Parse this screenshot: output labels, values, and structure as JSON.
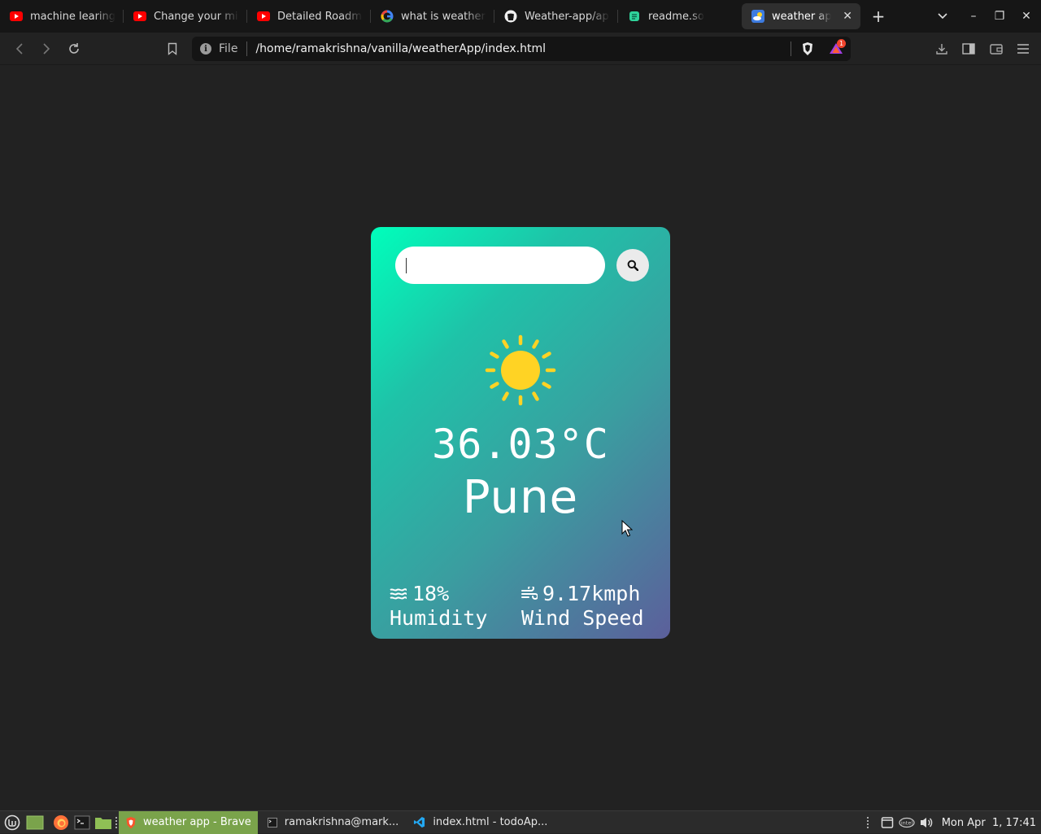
{
  "browser": {
    "tabs": [
      {
        "title": "machine learing ro",
        "icon": "youtube-icon"
      },
      {
        "title": "Change your mind",
        "icon": "youtube-icon"
      },
      {
        "title": "Detailed Roadmap",
        "icon": "youtube-icon"
      },
      {
        "title": "what is weather ap",
        "icon": "google-icon"
      },
      {
        "title": "Weather-app/app",
        "icon": "github-icon"
      },
      {
        "title": "readme.so",
        "icon": "readme-icon"
      },
      {
        "title": "weather app",
        "icon": "weather-icon",
        "active": true
      }
    ],
    "new_tab": "+",
    "address": {
      "scheme_label": "File",
      "url": "/home/ramakrishna/vanilla/weatherApp/index.html"
    },
    "rewards_badge": "1",
    "window_controls": {
      "minimize": "–",
      "maximize": "❐",
      "close": "✕"
    }
  },
  "weather": {
    "search": {
      "value": "",
      "placeholder": ""
    },
    "icon": "sun-icon",
    "temperature": "36.03°C",
    "city": "Pune",
    "humidity": {
      "value": "18%",
      "label": "Humidity"
    },
    "wind": {
      "value": "9.17kmph",
      "label": "Wind Speed"
    },
    "colors": {
      "gradient_start": "#00ffbb",
      "gradient_end": "#5c5f9b",
      "sun": "#ffd324"
    }
  },
  "taskbar": {
    "windows": [
      {
        "title": "weather app - Brave",
        "active": true
      },
      {
        "title": "ramakrishna@mark...",
        "active": false
      },
      {
        "title": "index.html - todoAp...",
        "active": false
      }
    ],
    "tray_brand": "intel",
    "clock": "Mon Apr  1, 17:41"
  }
}
